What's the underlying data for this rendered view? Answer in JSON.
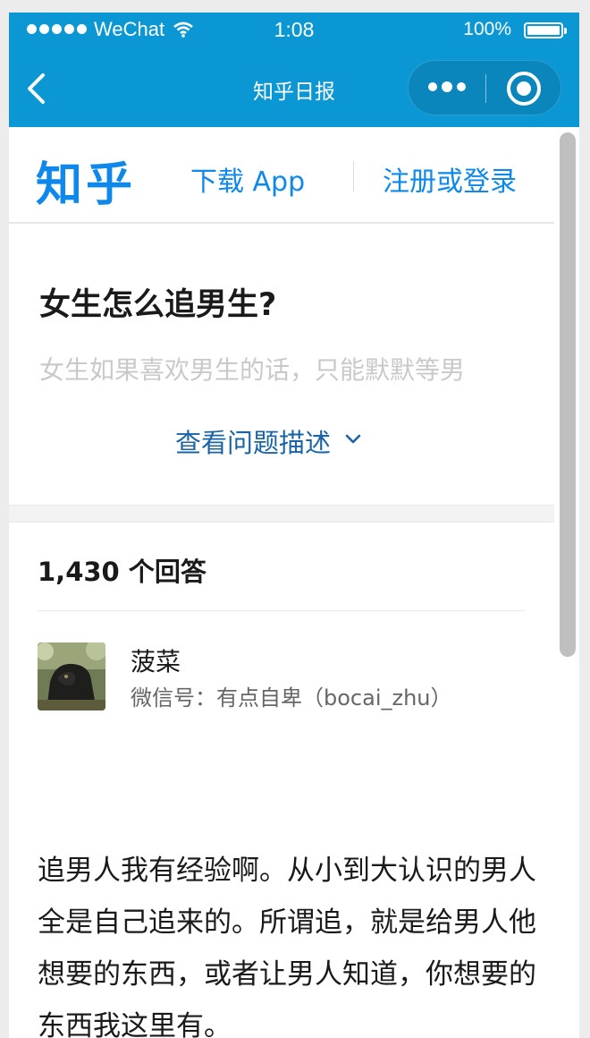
{
  "status_bar": {
    "carrier": "WeChat",
    "time": "1:08",
    "battery": "100%",
    "battery_level": 1.0
  },
  "nav": {
    "title": "知乎日报",
    "back_icon": "chevron-left-icon",
    "more_icon": "more-dots-icon",
    "close_icon": "mini-program-close-icon"
  },
  "header": {
    "logo": "知乎",
    "download": "下载 App",
    "login": "注册或登录"
  },
  "question": {
    "title": "女生怎么追男生?",
    "description": "女生如果喜欢男生的话，只能默默等男",
    "expand": "查看问题描述"
  },
  "answers": {
    "count": "1,430 个回答",
    "author": "菠菜",
    "bio": "微信号：有点自卑（bocai_zhu）",
    "body": "追男人我有经验啊。从小到大认识的男人全是自己追来的。所谓追，就是给男人他想要的东西，或者让男人知道，你想要的东西我这里有。"
  },
  "colors": {
    "brand": "#0f88eb",
    "appbar": "#0b97d3",
    "link": "#1a63a5"
  }
}
